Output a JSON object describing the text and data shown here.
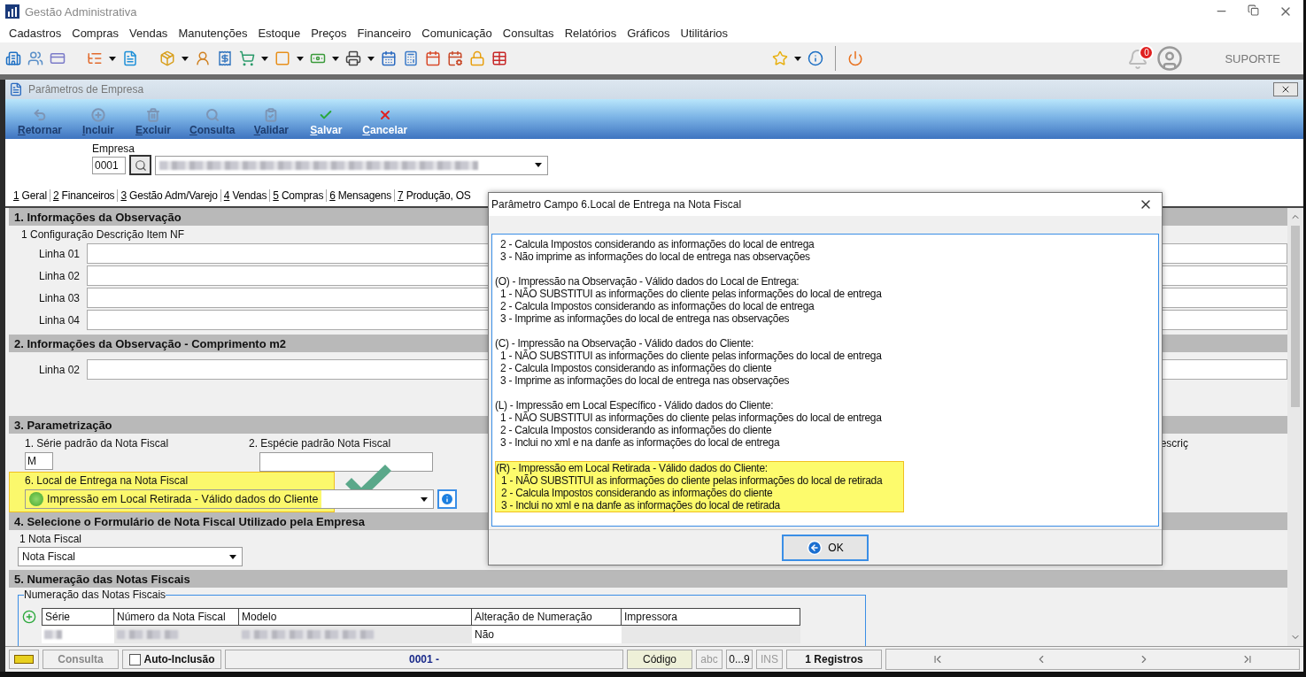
{
  "app": {
    "title": "Gestão Administrativa"
  },
  "menu": [
    "Cadastros",
    "Compras",
    "Vendas",
    "Manutenções",
    "Estoque",
    "Preços",
    "Financeiro",
    "Comunicação",
    "Consultas",
    "Relatórios",
    "Gráficos",
    "Utilitários"
  ],
  "header": {
    "notifications": "0",
    "user": "SUPORTE"
  },
  "child_window": {
    "title": "Parâmetros de Empresa"
  },
  "actions": [
    {
      "label": "Retornar",
      "disabled": true
    },
    {
      "label": "Incluir",
      "disabled": true
    },
    {
      "label": "Excluir",
      "disabled": true
    },
    {
      "label": "Consulta",
      "disabled": true
    },
    {
      "label": "Validar",
      "disabled": true
    },
    {
      "label": "Salvar",
      "disabled": false
    },
    {
      "label": "Cancelar",
      "disabled": false
    }
  ],
  "empresa": {
    "label": "Empresa",
    "code": "0001"
  },
  "tabs": [
    {
      "label": "1 Geral",
      "selected": false
    },
    {
      "label": "2 Financeiros",
      "selected": false
    },
    {
      "label": "3 Gestão Adm/Varejo",
      "selected": false
    },
    {
      "label": "4 Vendas",
      "selected": false
    },
    {
      "label": "5 Compras",
      "selected": false
    },
    {
      "label": "6 Mensagens",
      "selected": false
    },
    {
      "label": "7 Produção, OS",
      "selected": false
    }
  ],
  "section1": {
    "title": "1. Informações da Observação",
    "subtitle": "1 Configuração Descrição Item NF",
    "lines": [
      "Linha 01",
      "Linha 02",
      "Linha 03",
      "Linha 04"
    ]
  },
  "section2": {
    "title": "2. Informações da Observação - Comprimento m2",
    "lines": [
      "Linha 02"
    ]
  },
  "section3": {
    "title": "3. Parametrização",
    "serie": {
      "label": "1. Série padrão da Nota Fiscal",
      "value": "M"
    },
    "especie": {
      "label": "2. Espécie padrão Nota Fiscal"
    },
    "cut_label": "escriç",
    "local_entrega": {
      "label": "6. Local de Entrega na Nota Fiscal",
      "value": "Impressão em Local Retirada - Válido dados do Cliente",
      "highlighted": true
    }
  },
  "section4": {
    "title": "4. Selecione o Formulário de Nota Fiscal Utilizado pela Empresa",
    "label": "1 Nota Fiscal",
    "value": "Nota Fiscal"
  },
  "section5": {
    "title": "5. Numeração das Notas Fiscais",
    "group": "Numeração das Notas Fiscais",
    "columns": [
      "Série",
      "Número da Nota Fiscal",
      "Modelo",
      "Alteração de Numeração",
      "Impressora"
    ],
    "rows": [
      {
        "alteracao": "Não"
      }
    ]
  },
  "dialog": {
    "title": "Parâmetro Campo 6.Local de Entrega na Nota Fiscal",
    "ok": "OK",
    "blocks": [
      {
        "items": [
          "2 - Calcula Impostos considerando as informações do local de entrega",
          "3 - Não imprime as informações do local de entrega nas observações"
        ],
        "highlighted": false
      },
      {
        "heading": "(O) - Impressão na Observação - Válido dados do Local de Entrega:",
        "items": [
          "1 - NÃO SUBSTITUI as informações do cliente pelas informações do local de entrega",
          "2 - Calcula Impostos considerando as informações do local de entrega",
          "3 - Imprime as informações do local de entrega nas observações"
        ],
        "highlighted": false
      },
      {
        "heading": "(C) - Impressão na Observação - Válido dados do Cliente:",
        "items": [
          "1 - NÃO SUBSTITUI as informações do cliente pelas informações do local de entrega",
          "2 - Calcula Impostos considerando as informações do cliente",
          "3 - Imprime as informações do local de entrega nas observações"
        ],
        "highlighted": false
      },
      {
        "heading": "(L) - Impressão em Local Específico - Válido dados do Cliente:",
        "items": [
          "1 - NÃO SUBSTITUI as informações do cliente pelas informações do local de entrega",
          "2 - Calcula Impostos considerando as informações do cliente",
          "3 - Inclui no xml e na danfe as informações do local de entrega"
        ],
        "highlighted": false
      },
      {
        "heading": "(R) - Impressão em Local Retirada - Válido dados do Cliente:",
        "items": [
          "1 - NÃO SUBSTITUI as informações do cliente pelas informações do local de retirada",
          "2 - Calcula Impostos considerando as informações do cliente",
          "3 - Inclui no xml e na danfe as informações do local de retirada"
        ],
        "highlighted": true
      }
    ]
  },
  "status_bar": {
    "mode": "Consulta",
    "auto_inclusao": {
      "label": "Auto-Inclusão",
      "checked": false
    },
    "record": "0001 -",
    "key": "Código",
    "indicators": [
      "abc",
      "0...9",
      "INS"
    ],
    "count": "1 Registros"
  }
}
